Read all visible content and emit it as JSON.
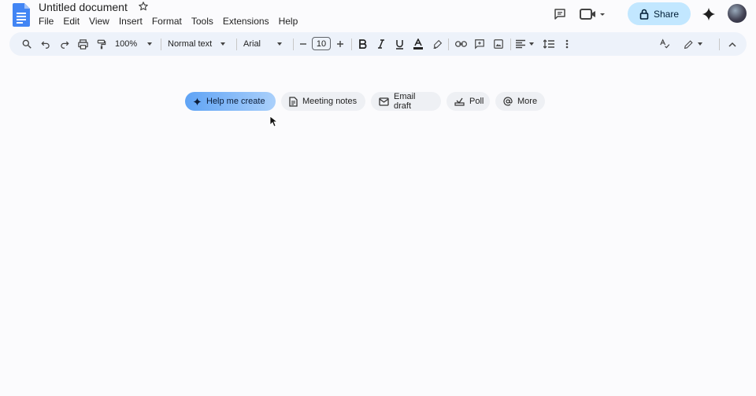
{
  "header": {
    "doc_title": "Untitled document",
    "menu": [
      "File",
      "Edit",
      "View",
      "Insert",
      "Format",
      "Tools",
      "Extensions",
      "Help"
    ],
    "share_label": "Share"
  },
  "toolbar": {
    "zoom": "100%",
    "style": "Normal text",
    "font": "Arial",
    "font_size": "10"
  },
  "chips": {
    "help_me_create": "Help me create",
    "meeting_notes": "Meeting notes",
    "email_draft": "Email draft",
    "poll": "Poll",
    "more": "More"
  },
  "colors": {
    "share_bg": "#c2e7ff",
    "toolbar_bg": "#edf2fa",
    "docs_blue": "#4285f4",
    "chip_accent": "#5fa3f5"
  }
}
